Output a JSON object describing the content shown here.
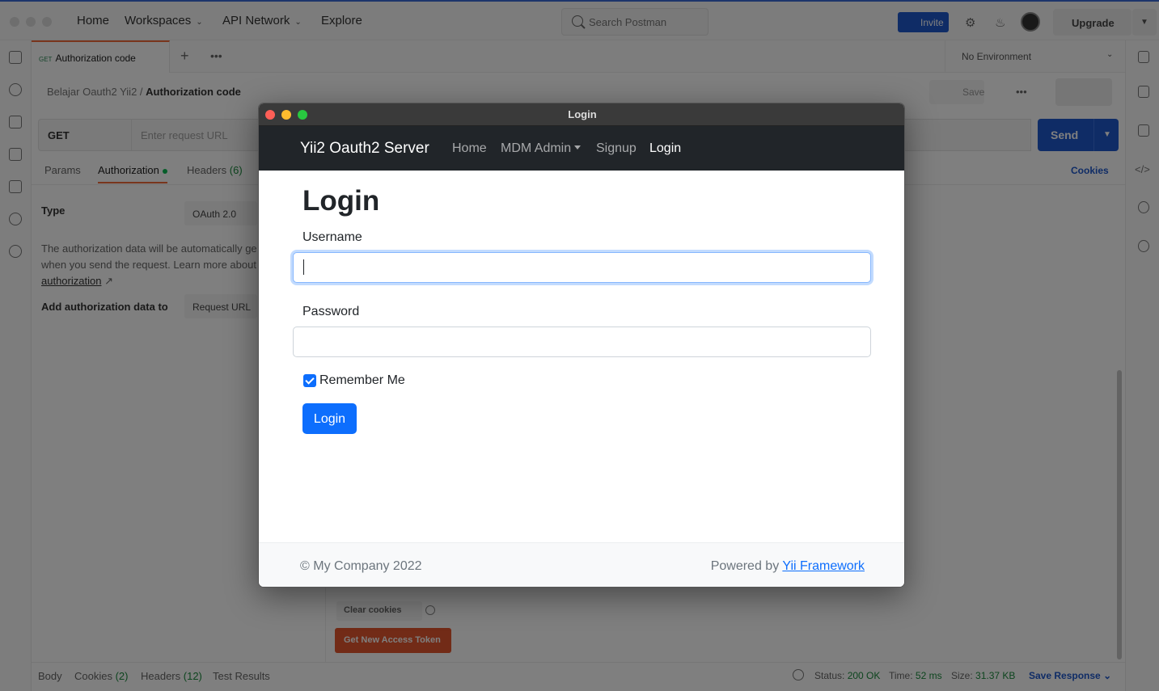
{
  "postman": {
    "nav": {
      "home": "Home",
      "workspaces": "Workspaces",
      "api_network": "API Network",
      "explore": "Explore",
      "search_placeholder": "Search Postman",
      "invite": "Invite",
      "upgrade": "Upgrade"
    },
    "tab": {
      "method": "GET",
      "label": "Authorization code"
    },
    "environment": "No Environment",
    "breadcrumb": {
      "collection": "Belajar Oauth2 Yii2",
      "separator": "/",
      "request": "Authorization code"
    },
    "save": "Save",
    "request": {
      "method": "GET",
      "url_placeholder": "Enter request URL",
      "send": "Send"
    },
    "request_tabs": {
      "params": "Params",
      "authorization": "Authorization",
      "headers": "Headers",
      "headers_count": "(6)",
      "cookies": "Cookies"
    },
    "auth": {
      "type_label": "Type",
      "type_value": "OAuth 2.0",
      "note": "The authorization data will be automatically ge",
      "note2": "when you send the request. Learn more about",
      "note_link": "authorization",
      "add_to_label": "Add authorization data to",
      "add_to_value": "Request URL",
      "clear_cookies": "Clear cookies",
      "get_token": "Get New Access Token"
    },
    "bottom": {
      "body": "Body",
      "cookies": "Cookies",
      "cookies_count": "(2)",
      "headers": "Headers",
      "headers_count": "(12)",
      "test_results": "Test Results",
      "status_label": "Status:",
      "status_value": "200 OK",
      "time_label": "Time:",
      "time_value": "52 ms",
      "size_label": "Size:",
      "size_value": "31.37 KB",
      "save_response": "Save Response"
    }
  },
  "popup": {
    "window_title": "Login",
    "navbar": {
      "brand": "Yii2 Oauth2 Server",
      "links": [
        "Home",
        "MDM Admin",
        "Signup",
        "Login"
      ],
      "active": "Login"
    },
    "heading": "Login",
    "username_label": "Username",
    "username_value": "",
    "password_label": "Password",
    "password_value": "",
    "remember_me": "Remember Me",
    "remember_checked": true,
    "login_button": "Login",
    "footer": {
      "copyright": "© My Company 2022",
      "powered_by": "Powered by",
      "framework_link": "Yii Framework"
    }
  },
  "colors": {
    "navbar_bg": "#212529",
    "primary": "#0d6efd",
    "postman_orange": "#e4572e",
    "postman_blue": "#1f58cc",
    "status_green": "#1a8a3c"
  }
}
